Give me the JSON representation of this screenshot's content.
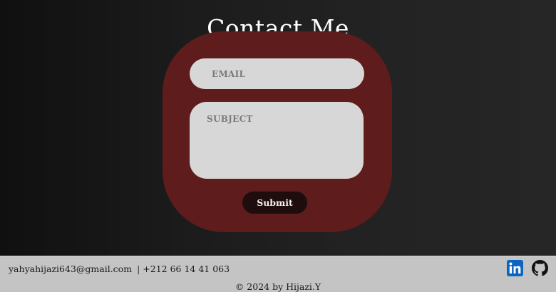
{
  "page": {
    "title": "Contact Me"
  },
  "form": {
    "email_placeholder": "EMAIL",
    "subject_placeholder": "SUBJECT",
    "submit_label": "Submit",
    "colors": {
      "panel": "#5e1c1c",
      "field": "#d7d7d7",
      "button": "#1f0d0d"
    }
  },
  "footer": {
    "email": "yahyahijazi643@gmail.com",
    "separator": "|",
    "phone": "+212 66 14 41 063",
    "copyright": "© 2024 by Hijazi.Y",
    "social": [
      {
        "icon": "linkedin-icon",
        "color": "#0a66c2"
      },
      {
        "icon": "github-icon",
        "color": "#111111"
      }
    ]
  }
}
